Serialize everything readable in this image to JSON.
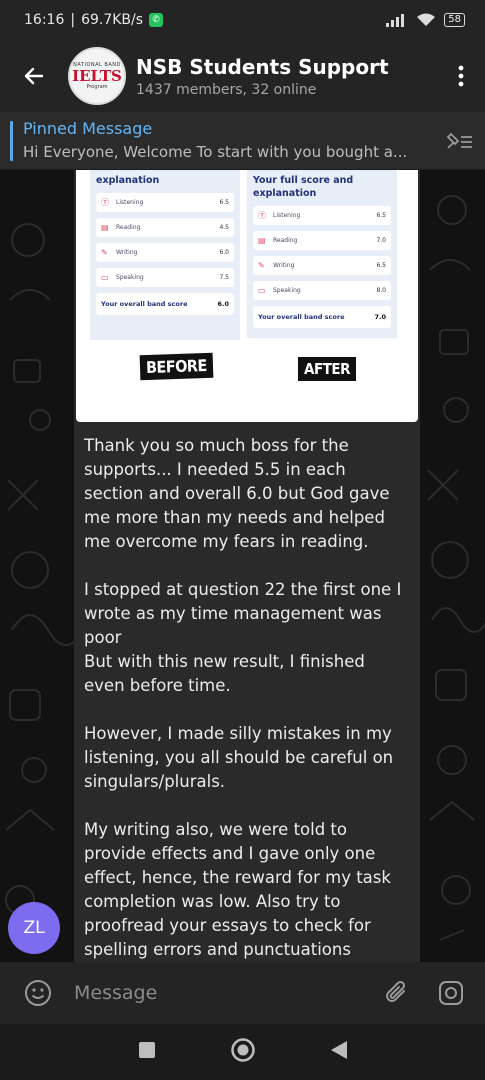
{
  "status_bar": {
    "time": "16:16",
    "speed": "69.7KB/s",
    "battery": "58"
  },
  "header": {
    "avatar": {
      "top": "NATIONAL BAND",
      "brand": "IELTS",
      "bottom": "Program"
    },
    "title": "NSB Students Support",
    "subtitle": "1437 members, 32 online"
  },
  "pinned": {
    "title": "Pinned Message",
    "body": "Hi Everyone,   Welcome  To start with you bought a..."
  },
  "photo": {
    "before": {
      "title": "explanation",
      "rows": [
        {
          "icon": "listening-icon",
          "glyph": "Ⓣ",
          "label": "Listening",
          "value": "6.5"
        },
        {
          "icon": "reading-icon",
          "glyph": "▤",
          "label": "Reading",
          "value": "4.5"
        },
        {
          "icon": "writing-icon",
          "glyph": "✎",
          "label": "Writing",
          "value": "6.0"
        },
        {
          "icon": "speaking-icon",
          "glyph": "▭",
          "label": "Speaking",
          "value": "7.5"
        }
      ],
      "overall_label": "Your overall band score",
      "overall_value": "6.0",
      "tag": "BEFORE"
    },
    "after": {
      "title": "Your full score and explanation",
      "rows": [
        {
          "icon": "listening-icon",
          "glyph": "Ⓣ",
          "label": "Listening",
          "value": "6.5"
        },
        {
          "icon": "reading-icon",
          "glyph": "▤",
          "label": "Reading",
          "value": "7.0"
        },
        {
          "icon": "writing-icon",
          "glyph": "✎",
          "label": "Writing",
          "value": "6.5"
        },
        {
          "icon": "speaking-icon",
          "glyph": "▭",
          "label": "Speaking",
          "value": "8.0"
        }
      ],
      "overall_label": "Your overall band score",
      "overall_value": "7.0",
      "tag": "AFTER"
    }
  },
  "message": {
    "text": "Thank you so much boss for the supports... I needed 5.5 in each section and overall 6.0 but God gave me more than my needs and helped me overcome my fears in reading.\n\nI stopped at question 22 the first one I wrote as my time management was poor\nBut with this new result, I finished even before time.\n\nHowever, I made silly mistakes in my listening, you all should be careful on singulars/plurals.\n\nMy writing also, we were told to provide effects and I gave only one effect, hence, the reward for my task completion was low. Also try to proofread your essays to check for spelling errors and punctuations",
    "sender_initials": "ZL"
  },
  "composer": {
    "placeholder": "Message"
  },
  "colors": {
    "accent": "#64b5f6",
    "avatar_zl": "#7c6cf0",
    "bubble": "#2a2a2a"
  }
}
